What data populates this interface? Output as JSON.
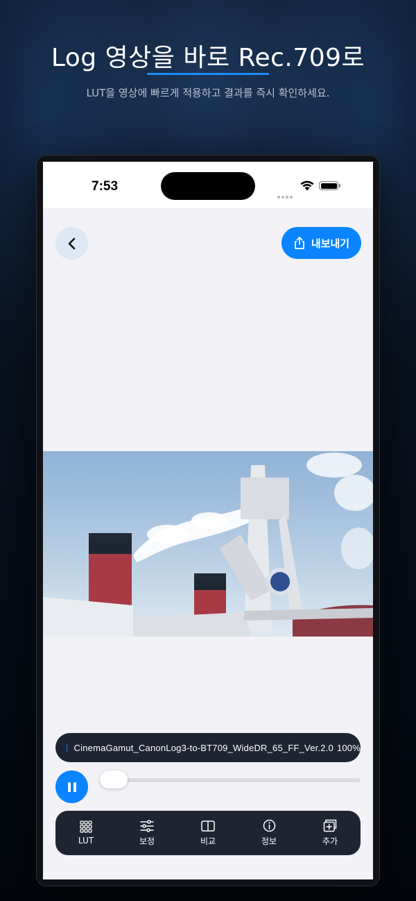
{
  "promo": {
    "title": "Log 영상을 바로 Rec.709로",
    "subtitle": "LUT을 영상에 빠르게 적용하고 결과를 즉시 확인하세요.",
    "accent_color": "#1f8bff"
  },
  "status_bar": {
    "time": "7:53"
  },
  "header": {
    "back_icon": "chevron-left-icon",
    "export_label": "내보내기",
    "export_icon": "share-icon"
  },
  "lut": {
    "name": "CinemaGamut_CanonLog3-to-BT709_WideDR_65_FF_Ver.2.0",
    "intensity": "100%"
  },
  "player": {
    "state_icon": "pause-icon",
    "progress": 0.0
  },
  "tabs": [
    {
      "label": "LUT",
      "icon": "grid-icon"
    },
    {
      "label": "보정",
      "icon": "sliders-icon"
    },
    {
      "label": "비교",
      "icon": "split-view-icon"
    },
    {
      "label": "정보",
      "icon": "info-icon"
    },
    {
      "label": "추가",
      "icon": "add-layer-icon"
    }
  ],
  "colors": {
    "primary": "#0a84ff",
    "dark_panel": "#1f2433",
    "screen_bg": "#f2f2f7"
  }
}
